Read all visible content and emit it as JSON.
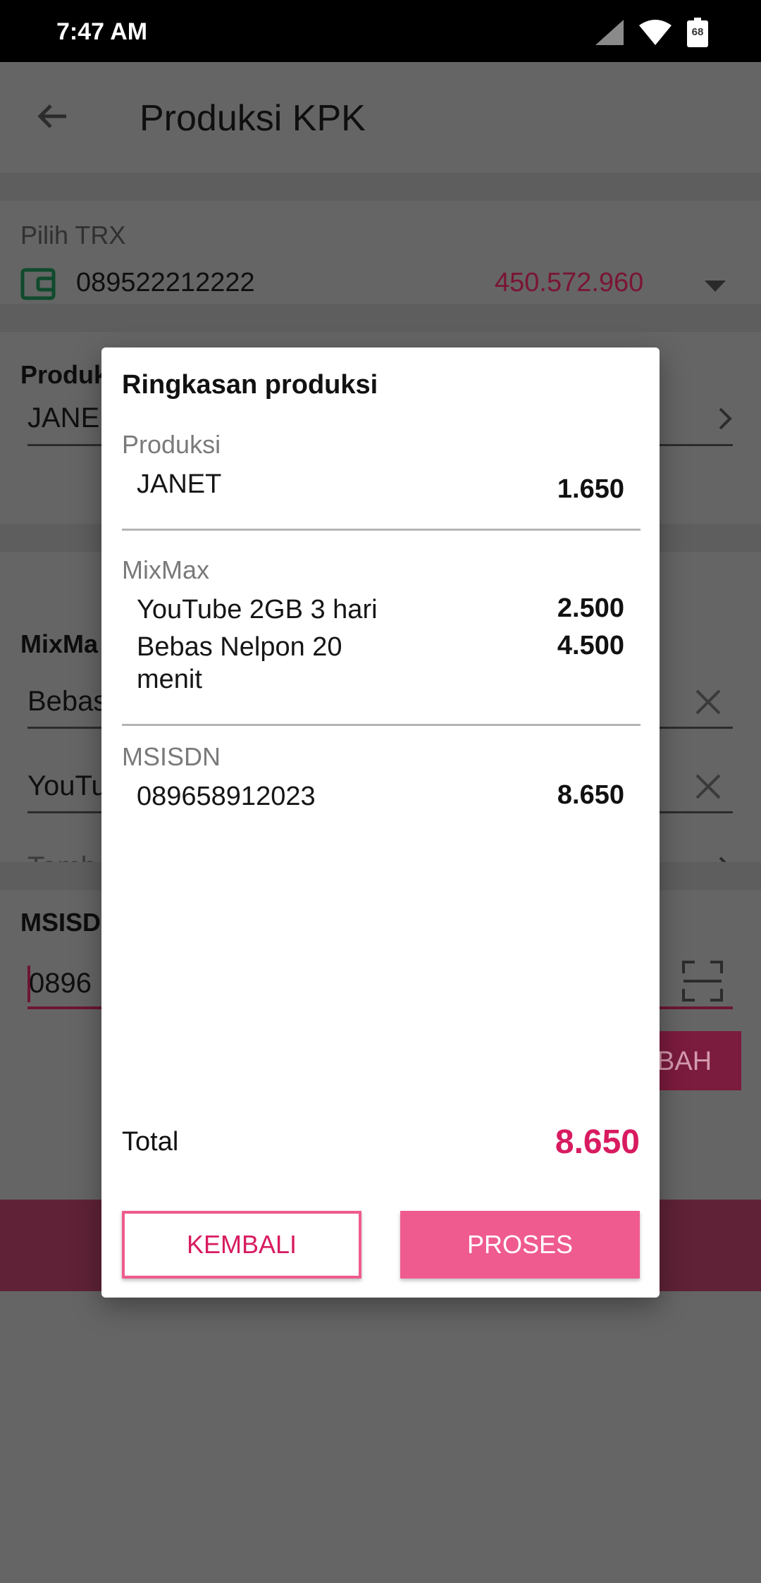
{
  "status_bar": {
    "time": "7:47 AM",
    "battery": "68"
  },
  "app": {
    "title": "Produksi KPK",
    "trx": {
      "label": "Pilih TRX",
      "number": "089522212222",
      "balance": "450.572.960"
    },
    "produksi": {
      "label": "Produk",
      "value": "JANE"
    },
    "mixmax": {
      "label": "MixMa",
      "items": [
        "Bebas",
        "YouTu"
      ],
      "add_hint": "Tamb"
    },
    "msisdn": {
      "label": "MSISD",
      "value": "0896",
      "add_button": "BAH"
    }
  },
  "dialog": {
    "title": "Ringkasan produksi",
    "produksi": {
      "label": "Produksi",
      "items": [
        {
          "name": "JANET",
          "price": "1.650"
        }
      ]
    },
    "mixmax": {
      "label": "MixMax",
      "items": [
        {
          "name": "YouTube 2GB 3 hari",
          "price": "2.500"
        },
        {
          "name": "Bebas Nelpon 20\nmenit",
          "price": "4.500"
        }
      ]
    },
    "msisdn": {
      "label": "MSISDN",
      "items": [
        {
          "name": "089658912023",
          "price": "8.650"
        }
      ]
    },
    "total_label": "Total",
    "total_value": "8.650",
    "back_button": "KEMBALI",
    "process_button": "PROSES"
  },
  "colors": {
    "accent": "#d81b60",
    "button_pink": "#ef5b8f",
    "balance": "#7a1534"
  }
}
